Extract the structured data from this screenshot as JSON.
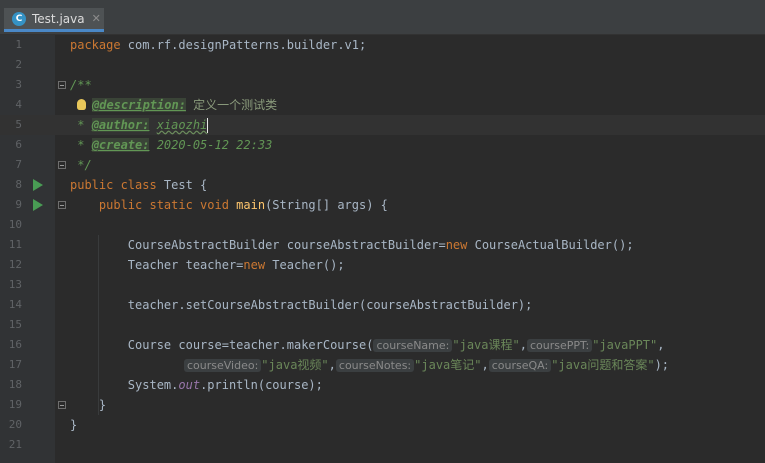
{
  "tab": {
    "icon_letter": "C",
    "filename": "Test.java",
    "close": "✕"
  },
  "line_numbers": [
    "1",
    "2",
    "3",
    "4",
    "5",
    "6",
    "7",
    "8",
    "9",
    "10",
    "11",
    "12",
    "13",
    "14",
    "15",
    "16",
    "17",
    "18",
    "19",
    "20",
    "21"
  ],
  "code": {
    "l1_kw": "package",
    "l1_rest": " com.rf.designPatterns.builder.v1;",
    "l3": "/**",
    "l4_tag": "@description:",
    "l4_text": " 定义一个测试类",
    "l5_star": " * ",
    "l5_tag": "@author:",
    "l5_text": "xiaozhi",
    "l6_star": " * ",
    "l6_tag": "@create:",
    "l6_text": " 2020-05-12 22:33",
    "l7": " */",
    "l8_kw": "public class",
    "l8_rest": " Test {",
    "l9_kw": "    public static void",
    "l9_fn": " main",
    "l9_rest": "(String[] args) {",
    "l11_a": "        CourseAbstractBuilder courseAbstractBuilder=",
    "l11_kw": "new",
    "l11_b": " CourseActualBuilder();",
    "l12_a": "        Teacher teacher=",
    "l12_kw": "new",
    "l12_b": " Teacher();",
    "l14": "        teacher.setCourseAbstractBuilder(courseAbstractBuilder);",
    "l16_a": "        Course course=teacher.makerCourse(",
    "l16_h1": "courseName:",
    "l16_s1": "\"java课程\"",
    "l16_c1": ",",
    "l16_h2": "coursePPT:",
    "l16_s2": "\"javaPPT\"",
    "l16_c2": ",",
    "l17_h1": "courseVideo:",
    "l17_s1": "\"java视频\"",
    "l17_c1": ",",
    "l17_h2": "courseNotes:",
    "l17_s2": "\"java笔记\"",
    "l17_c2": ",",
    "l17_h3": "courseQA:",
    "l17_s3": "\"java问题和答案\"",
    "l17_end": ");",
    "l18_a": "        System.",
    "l18_out": "out",
    "l18_b": ".println(course);",
    "l19": "    }",
    "l20": "}"
  },
  "colors": {
    "keyword": "#cc7832",
    "comment": "#629755",
    "string": "#6a8759",
    "method": "#ffc66d",
    "default_text": "#a9b7c6",
    "background": "#2b2b2b"
  }
}
